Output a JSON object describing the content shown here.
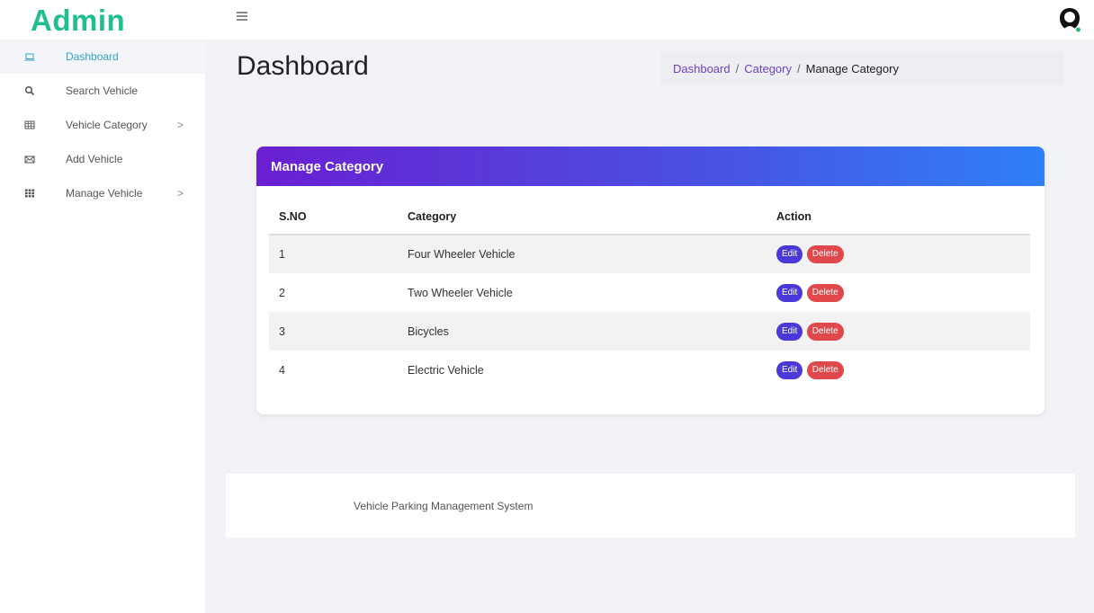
{
  "brand": "Admin",
  "sidebar": {
    "items": [
      {
        "label": "Dashboard",
        "icon": "laptop-icon",
        "active": true
      },
      {
        "label": "Search Vehicle",
        "icon": "search-icon"
      },
      {
        "label": "Vehicle Category",
        "icon": "table-icon",
        "chevron": ">"
      },
      {
        "label": "Add Vehicle",
        "icon": "envelope-icon"
      },
      {
        "label": "Manage Vehicle",
        "icon": "grid-icon",
        "chevron": ">"
      }
    ]
  },
  "header": {
    "menu_icon": "hamburger-icon",
    "avatar_icon": "user-avatar-icon"
  },
  "page": {
    "title": "Dashboard",
    "breadcrumb": {
      "items": [
        "Dashboard",
        "Category"
      ],
      "separator": "/",
      "current": "Manage Category"
    }
  },
  "card": {
    "title": "Manage Category",
    "table": {
      "headers": [
        "S.NO",
        "Category",
        "Action"
      ],
      "rows": [
        {
          "sno": "1",
          "category": "Four Wheeler Vehicle"
        },
        {
          "sno": "2",
          "category": "Two Wheeler Vehicle"
        },
        {
          "sno": "3",
          "category": "Bicycles"
        },
        {
          "sno": "4",
          "category": "Electric Vehicle"
        }
      ],
      "edit_label": "Edit",
      "delete_label": "Delete"
    }
  },
  "footer": {
    "text": "Vehicle Parking Management System"
  },
  "colors": {
    "brand": "#1fbf8f",
    "link": "#6f42c1",
    "edit_button": "#4b38d8",
    "delete_button": "#e0484b",
    "header_gradient_start": "#6a1fd1",
    "header_gradient_end": "#2f80f8"
  }
}
